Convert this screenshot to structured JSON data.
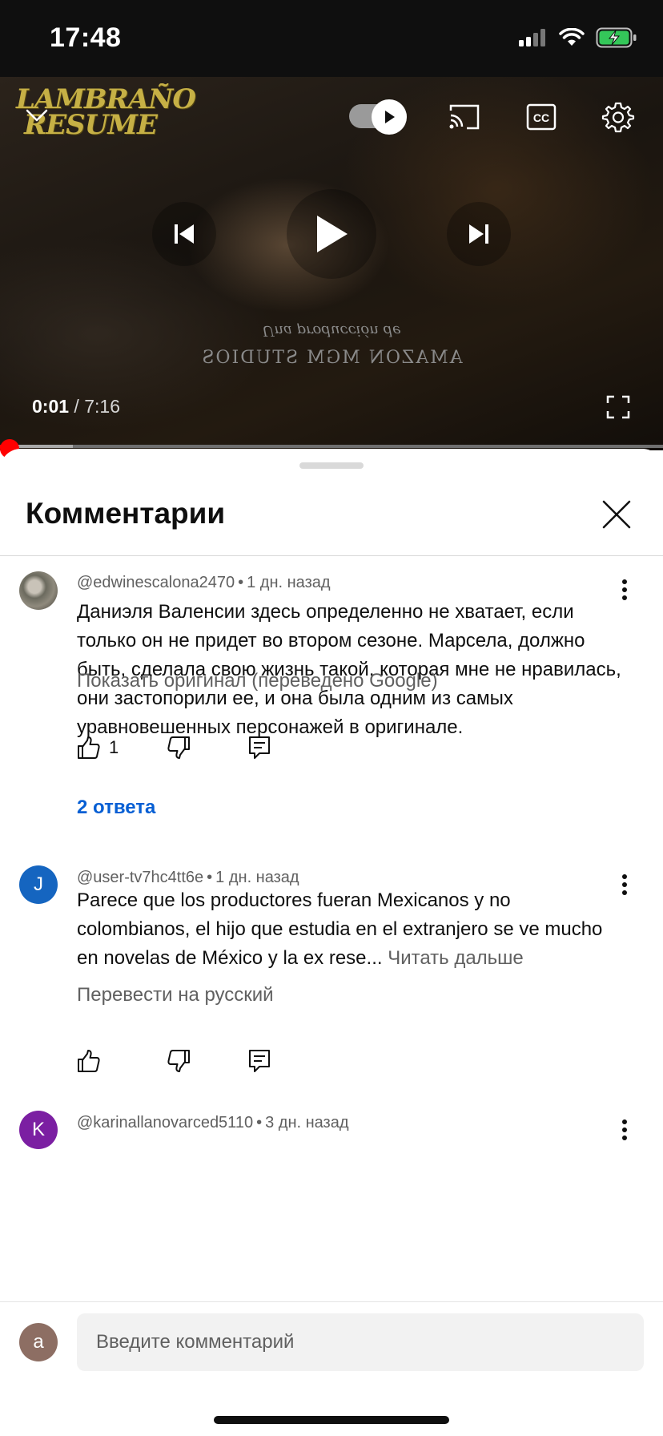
{
  "status_bar": {
    "time": "17:48",
    "icons": [
      "signal-icon",
      "wifi-icon",
      "battery-charging-icon"
    ]
  },
  "player": {
    "channel_logo_line1": "LAMBRAÑO",
    "channel_logo_line2": "RESUME",
    "overlay_line1": "Una producción de",
    "overlay_line2": "AMAZON MGM STUDIOS",
    "current_time": "0:01",
    "separator": " / ",
    "duration": "7:16",
    "progress_played_fraction": 0.002,
    "progress_buffered_fraction": 0.11,
    "autoplay_on": true,
    "icons": [
      "chevron-down-icon",
      "autoplay-toggle",
      "cast-icon",
      "captions-icon",
      "settings-icon",
      "previous-icon",
      "play-icon",
      "next-icon",
      "fullscreen-icon"
    ]
  },
  "comments_panel": {
    "title": "Комментарии",
    "comments": [
      {
        "author": "@edwinescalona2470",
        "time": "1 дн. назад",
        "text": "Даниэля Валенсии здесь определенно не хватает, если только он не придет во втором сезоне. Марсела, должно быть, сделала свою жизнь такой, которая мне не нравилась, они застопорили ее, и она была одним из самых уравновешенных персонажей в оригинале.",
        "translate_label": "Показать оригинал (переведено Google)",
        "likes": "1",
        "replies_label": "2 ответа"
      },
      {
        "author": "@user-tv7hc4tt6e",
        "avatar_letter": "J",
        "avatar_color": "#1565c0",
        "time": "1 дн. назад",
        "text": "Parece que los productores fueran Mexicanos y no colombianos, el hijo que estudia en el extranjero se ve mucho en novelas de México y la ex rese...",
        "read_more": "Читать дальше",
        "translate_label": "Перевести на русский"
      },
      {
        "author": "@karinallanovarced5110",
        "avatar_letter": "K",
        "avatar_color": "#7b1fa2",
        "time": "3 дн. назад"
      }
    ],
    "composer": {
      "avatar_letter": "a",
      "placeholder": "Введите комментарий"
    }
  }
}
